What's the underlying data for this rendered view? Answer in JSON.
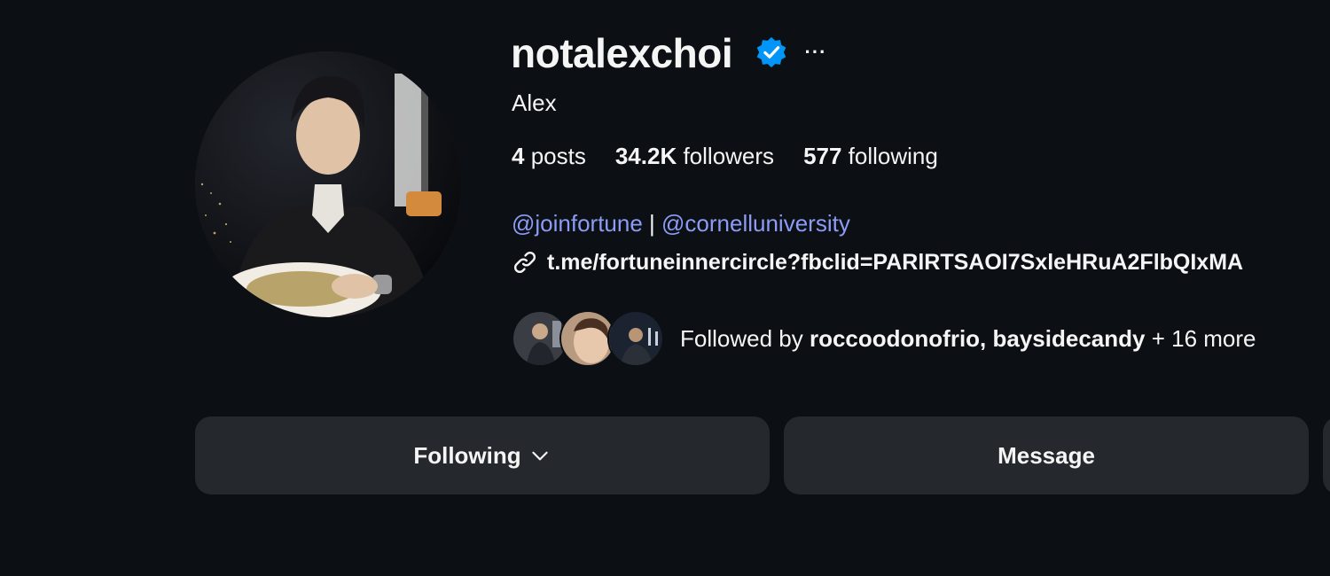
{
  "profile": {
    "username": "notalexchoi",
    "full_name": "Alex",
    "more_glyph": "···"
  },
  "stats": {
    "posts_count": "4",
    "posts_label": " posts",
    "followers_count": "34.2K",
    "followers_label": " followers",
    "following_count": "577",
    "following_label": " following"
  },
  "bio": {
    "mention_1": "@joinfortune",
    "separator": " | ",
    "mention_2": "@cornelluniversity",
    "link": "t.me/fortuneinnercircle?fbclid=PARlRTSAOI7SxleHRuA2FlbQIxMA"
  },
  "followed_by": {
    "prefix": "Followed by ",
    "users": "roccoodonofrio, baysidecandy",
    "suffix": " + 16 more"
  },
  "buttons": {
    "following_label": "Following",
    "message_label": "Message"
  },
  "icons": {
    "verified": "verified-badge-icon",
    "link": "link-icon",
    "chevron": "chevron-down-icon",
    "more": "more-options-icon"
  },
  "colors": {
    "background": "#0c1014",
    "text": "#f5f5f5",
    "mention": "#8c9cf6",
    "verified_blue": "#0095f6",
    "button_bg": "#25292e"
  }
}
